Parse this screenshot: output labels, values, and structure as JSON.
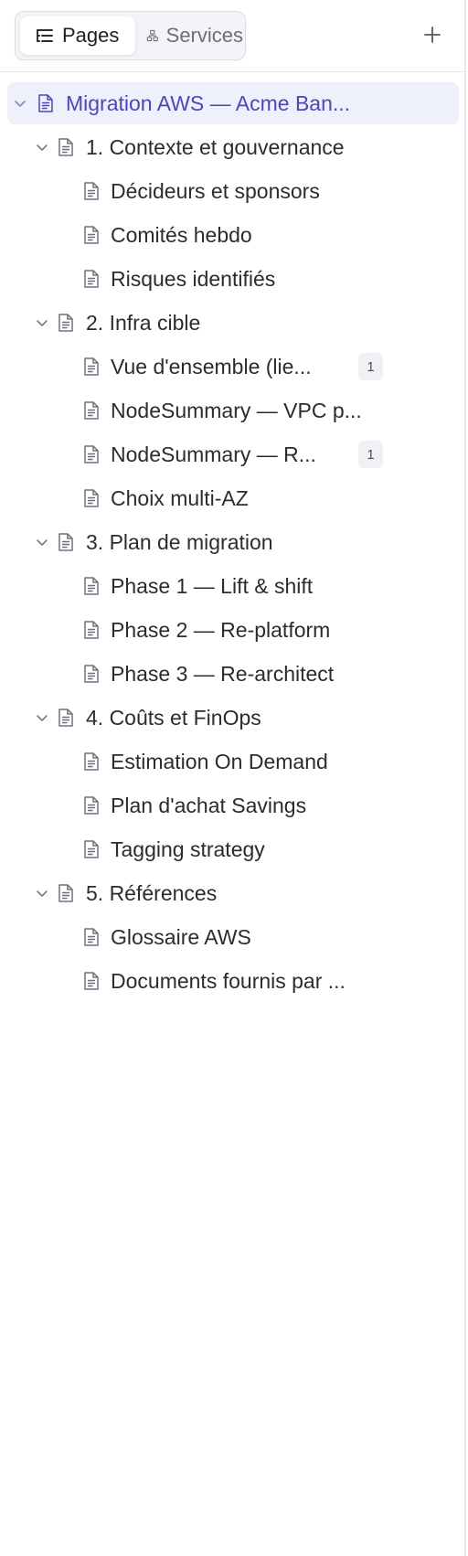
{
  "header": {
    "tabs": [
      {
        "label": "Pages",
        "icon": "list-tree-icon",
        "active": true
      },
      {
        "label": "Services",
        "icon": "network-icon",
        "active": false
      }
    ],
    "add_icon": "plus-icon"
  },
  "tree": [
    {
      "label": "Migration AWS — Acme Ban...",
      "level": 0,
      "expanded": true,
      "selected": true
    },
    {
      "label": "1. Contexte et gouvernance",
      "level": 1,
      "expanded": true
    },
    {
      "label": "Décideurs et sponsors",
      "level": 2
    },
    {
      "label": "Comités hebdo",
      "level": 2
    },
    {
      "label": "Risques identifiés",
      "level": 2
    },
    {
      "label": "2. Infra cible",
      "level": 1,
      "expanded": true
    },
    {
      "label": "Vue d'ensemble (lie...",
      "level": 2,
      "badge": "1"
    },
    {
      "label": "NodeSummary — VPC p...",
      "level": 2
    },
    {
      "label": "NodeSummary — R...",
      "level": 2,
      "badge": "1"
    },
    {
      "label": "Choix multi-AZ",
      "level": 2
    },
    {
      "label": "3. Plan de migration",
      "level": 1,
      "expanded": true
    },
    {
      "label": "Phase 1 — Lift & shift",
      "level": 2
    },
    {
      "label": "Phase 2 — Re-platform",
      "level": 2
    },
    {
      "label": "Phase 3 — Re-architect",
      "level": 2
    },
    {
      "label": "4. Coûts et FinOps",
      "level": 1,
      "expanded": true
    },
    {
      "label": "Estimation On Demand",
      "level": 2
    },
    {
      "label": "Plan d'achat Savings",
      "level": 2
    },
    {
      "label": "Tagging strategy",
      "level": 2
    },
    {
      "label": "5. Références",
      "level": 1,
      "expanded": true
    },
    {
      "label": "Glossaire AWS",
      "level": 2
    },
    {
      "label": "Documents fournis par ...",
      "level": 2
    }
  ],
  "colors": {
    "accent": "#4a48b8",
    "selected_bg": "#eef0fb",
    "text": "#2b2b33",
    "icon": "#6f717b"
  }
}
